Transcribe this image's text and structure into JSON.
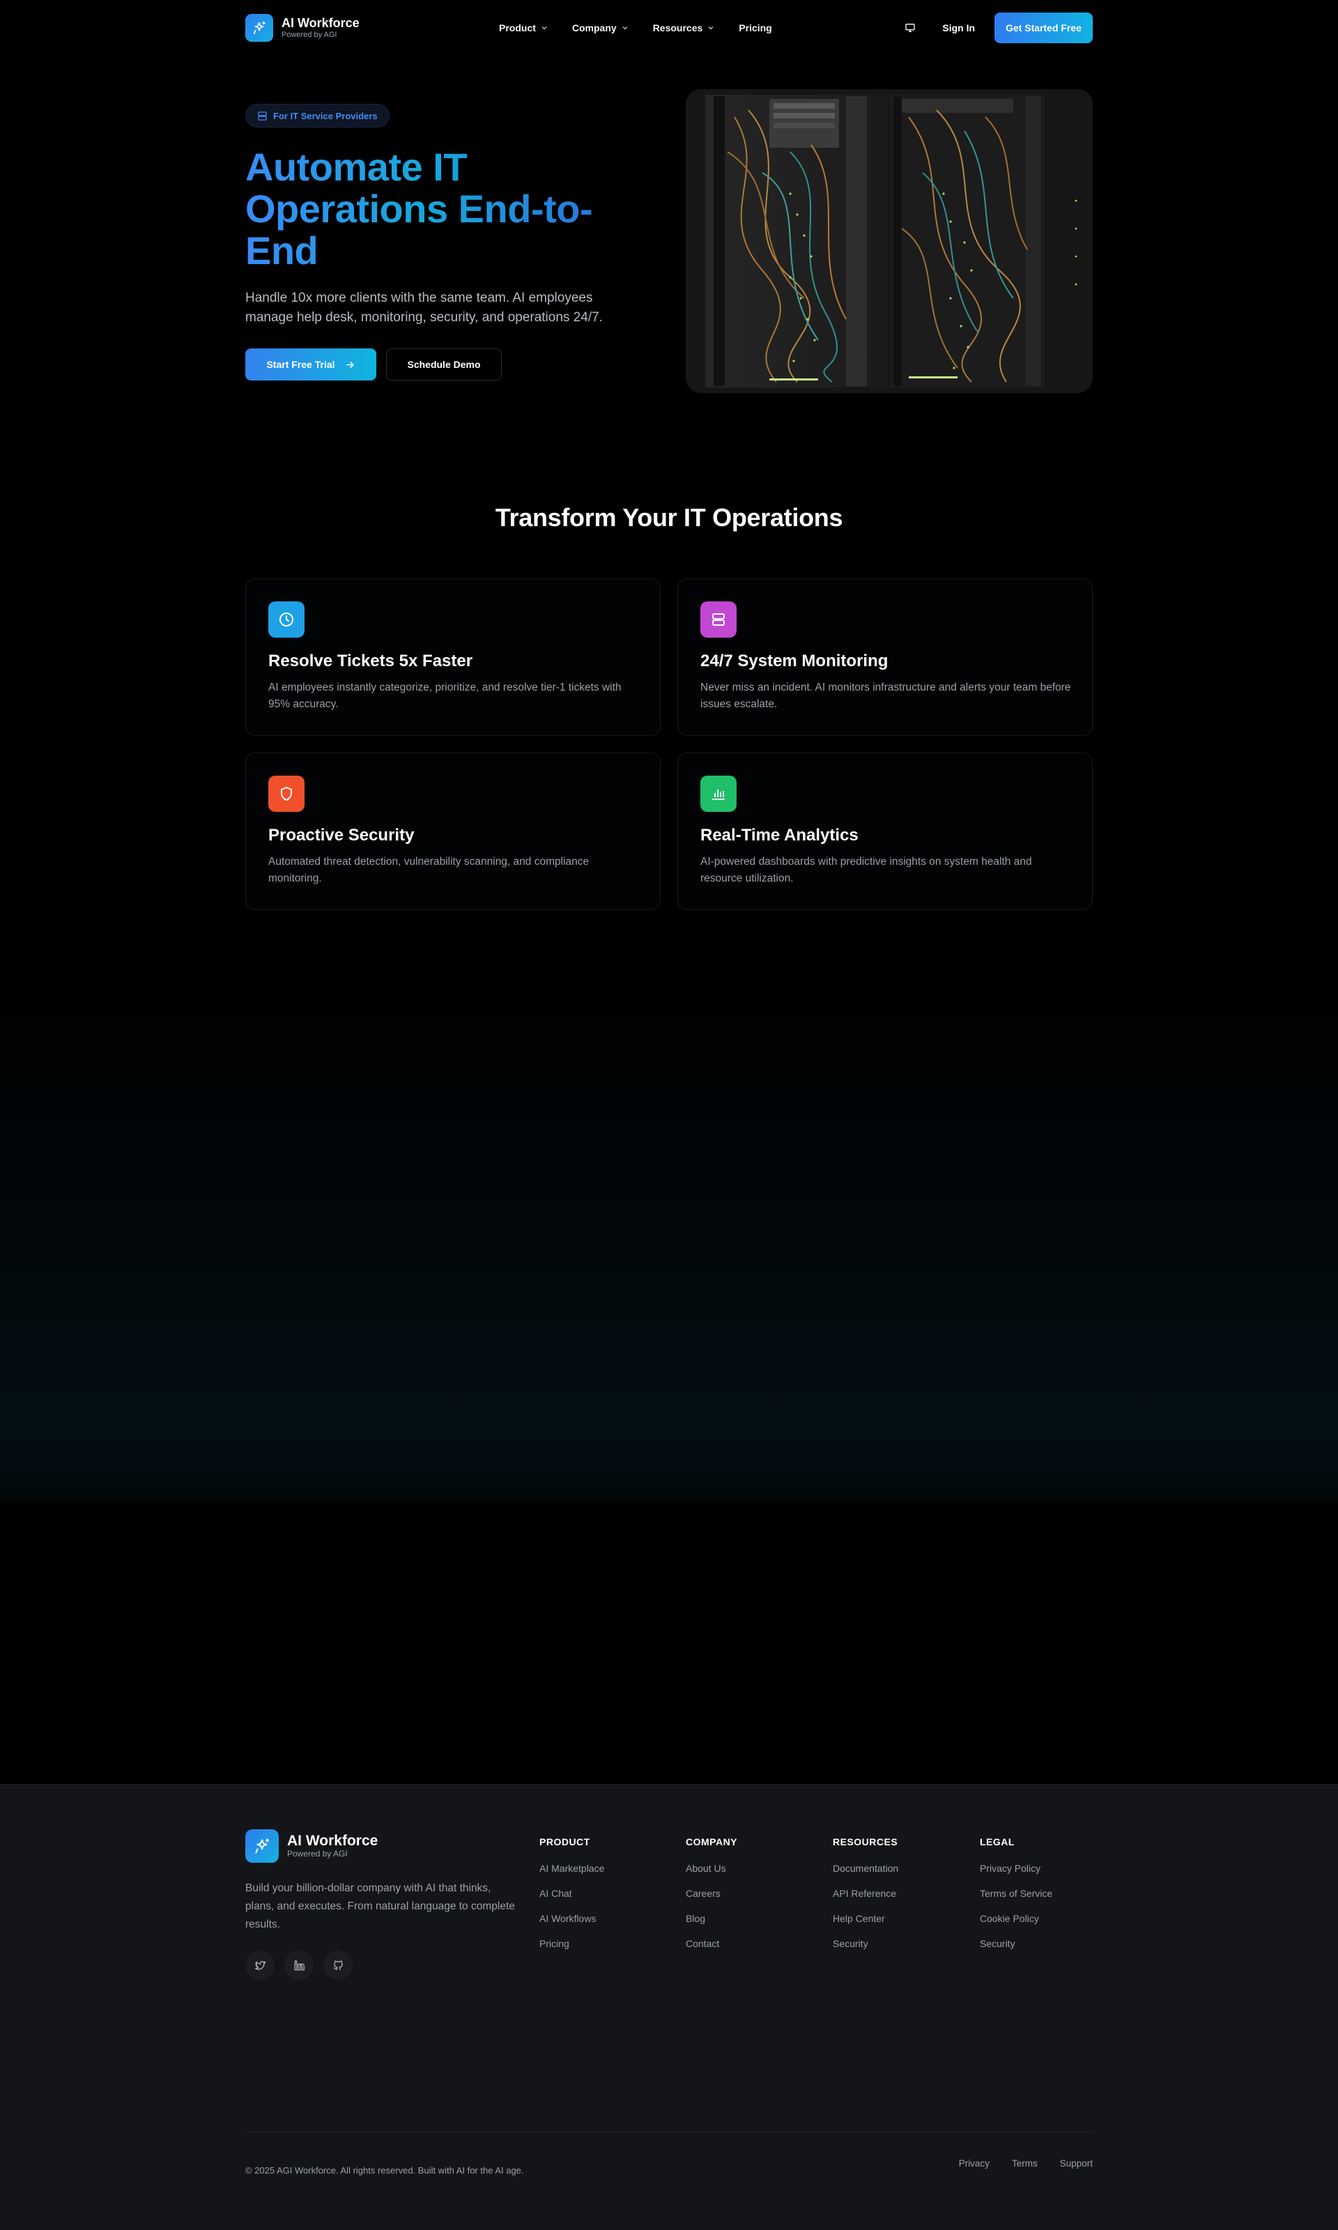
{
  "brand": {
    "name": "AI Workforce",
    "tagline": "Powered by AGI"
  },
  "nav": {
    "links": [
      {
        "label": "Product",
        "has_dropdown": true
      },
      {
        "label": "Company",
        "has_dropdown": true
      },
      {
        "label": "Resources",
        "has_dropdown": true
      },
      {
        "label": "Pricing",
        "has_dropdown": false
      }
    ],
    "monitor_icon": "monitor-icon",
    "sign_in": "Sign In",
    "cta": "Get Started Free"
  },
  "hero": {
    "badge": "For IT Service Providers",
    "title": "Automate IT Operations End-to-End",
    "subtitle": "Handle 10x more clients with the same team. AI employees manage help desk, monitoring, security, and operations 24/7.",
    "primary_button": "Start Free Trial",
    "secondary_button": "Schedule Demo"
  },
  "features": {
    "title": "Transform Your IT Operations",
    "cards": [
      {
        "title": "Resolve Tickets 5x Faster",
        "description": "AI employees instantly categorize, prioritize, and resolve tier-1 tickets with 95% accuracy.",
        "icon": "clock-icon",
        "color": "#1ea1e6"
      },
      {
        "title": "24/7 System Monitoring",
        "description": "Never miss an incident. AI monitors infrastructure and alerts your team before issues escalate.",
        "icon": "server-icon",
        "color": "#c248d4"
      },
      {
        "title": "Proactive Security",
        "description": "Automated threat detection, vulnerability scanning, and compliance monitoring.",
        "icon": "shield-icon",
        "color": "#f0502b"
      },
      {
        "title": "Real-Time Analytics",
        "description": "AI-powered dashboards with predictive insights on system health and resource utilization.",
        "icon": "bar-chart-icon",
        "color": "#1fbf6a"
      }
    ]
  },
  "footer": {
    "description": "Build your billion-dollar company with AI that thinks, plans, and executes. From natural language to complete results.",
    "socials": [
      "twitter-icon",
      "linkedin-icon",
      "github-icon"
    ],
    "columns": [
      {
        "heading": "PRODUCT",
        "links": [
          "AI Marketplace",
          "AI Chat",
          "AI Workflows",
          "Pricing"
        ]
      },
      {
        "heading": "COMPANY",
        "links": [
          "About Us",
          "Careers",
          "Blog",
          "Contact"
        ]
      },
      {
        "heading": "RESOURCES",
        "links": [
          "Documentation",
          "API Reference",
          "Help Center",
          "Security"
        ]
      },
      {
        "heading": "LEGAL",
        "links": [
          "Privacy Policy",
          "Terms of Service",
          "Cookie Policy",
          "Security"
        ]
      }
    ],
    "copyright": "© 2025 AGI Workforce. All rights reserved. Built with AI for the AI age.",
    "bottom_links": [
      "Privacy",
      "Terms",
      "Support"
    ]
  }
}
